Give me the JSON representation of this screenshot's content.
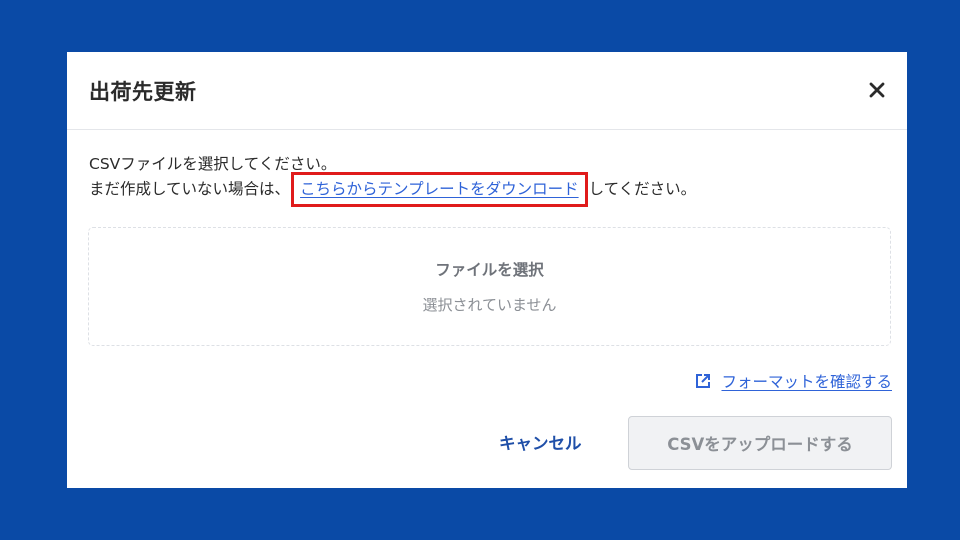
{
  "dialog": {
    "title": "出荷先更新",
    "close_icon": "close-icon",
    "instruction_line1": "CSVファイルを選択してください。",
    "instruction_line2_prefix": "まだ作成していない場合は、",
    "template_link": "こちらからテンプレートをダウンロード",
    "instruction_line2_suffix": "してください。",
    "file_select": {
      "label": "ファイルを選択",
      "status": "選択されていません"
    },
    "format_link": {
      "icon": "external-link-icon",
      "label": "フォーマットを確認する"
    },
    "cancel_label": "キャンセル",
    "upload_label": "CSVをアップロードする"
  },
  "colors": {
    "background": "#0a4aa6",
    "link": "#2f63d8",
    "highlight_box": "#e01b1b",
    "cancel": "#1f4fa8",
    "disabled_button_bg": "#f1f2f4"
  }
}
